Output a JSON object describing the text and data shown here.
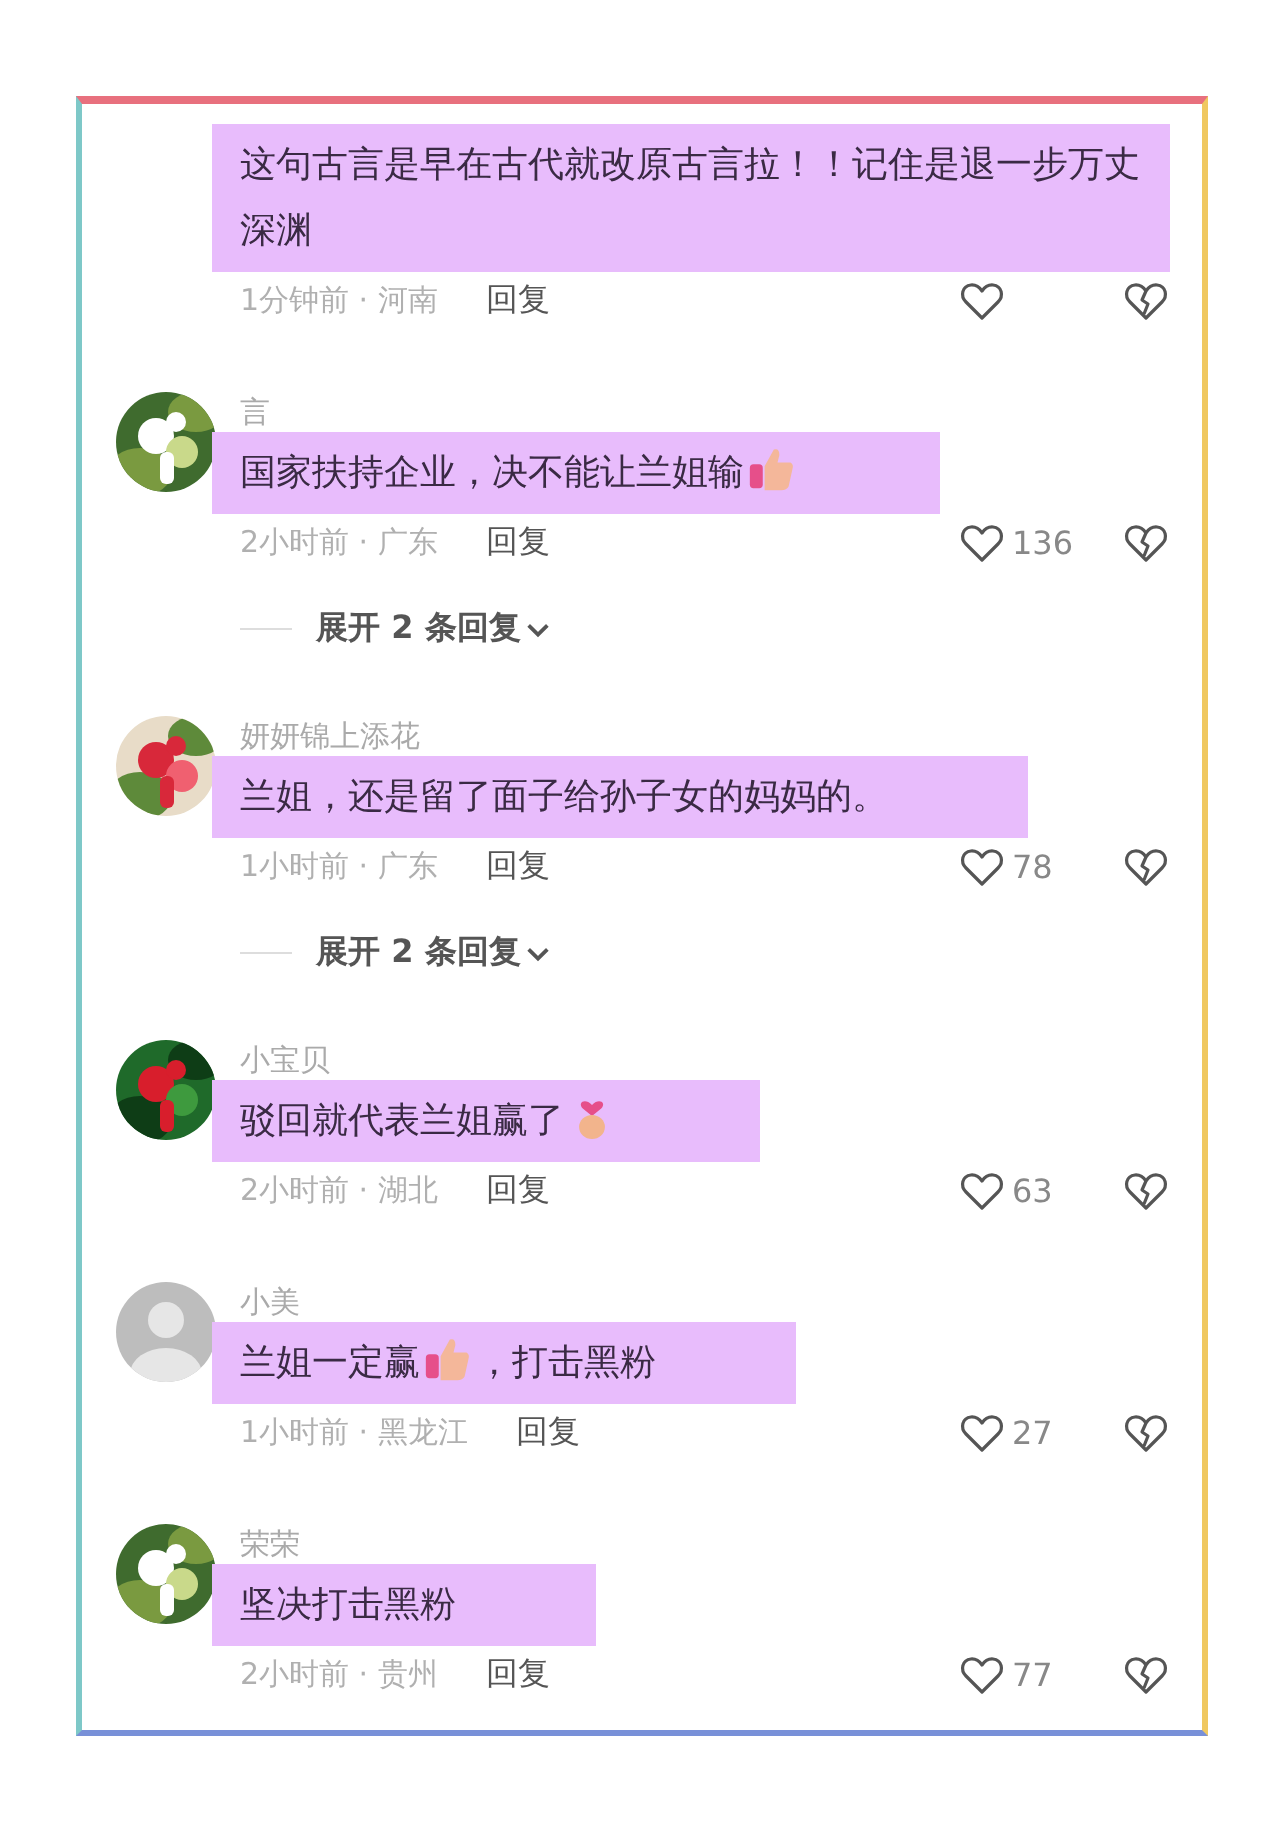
{
  "comments": [
    {
      "parts": [
        {
          "kind": "text",
          "text": "这句古言是早在古代就改原古言拉！！记住是退一步万丈深渊"
        }
      ],
      "time_place": "1分钟前 · 河南",
      "reply": "回复"
    },
    {
      "avatar": {
        "kind": "picture"
      },
      "name": "言",
      "parts": [
        {
          "kind": "text",
          "text": "国家扶持企业，决不能让兰姐输"
        },
        {
          "kind": "thumbs-up"
        }
      ],
      "time_place": "2小时前 · 广东",
      "reply": "回复",
      "likes": "136",
      "expand": "展开 2 条回复"
    },
    {
      "avatar": {
        "kind": "picture"
      },
      "name": "妍妍锦上添花",
      "parts": [
        {
          "kind": "text",
          "text": "兰姐，还是留了面子给孙子女的妈妈的。"
        }
      ],
      "time_place": "1小时前 · 广东",
      "reply": "回复",
      "likes": "78",
      "expand": "展开 2 条回复"
    },
    {
      "avatar": {
        "kind": "picture"
      },
      "name": "小宝贝",
      "parts": [
        {
          "kind": "text",
          "text": "驳回就代表兰姐赢了"
        },
        {
          "kind": "finger-heart"
        }
      ],
      "time_place": "2小时前 · 湖北",
      "reply": "回复",
      "likes": "63"
    },
    {
      "avatar": {
        "kind": "default"
      },
      "name": "小美",
      "parts": [
        {
          "kind": "text",
          "text": "兰姐一定赢"
        },
        {
          "kind": "thumbs-up"
        },
        {
          "kind": "text",
          "text": "，打击黑粉"
        }
      ],
      "time_place": "1小时前 · 黑龙江",
      "reply": "回复",
      "likes": "27"
    },
    {
      "avatar": {
        "kind": "picture"
      },
      "name": "荣荣",
      "parts": [
        {
          "kind": "text",
          "text": "坚决打击黑粉"
        }
      ],
      "time_place": "2小时前 · 贵州",
      "reply": "回复",
      "likes": "77"
    }
  ]
}
